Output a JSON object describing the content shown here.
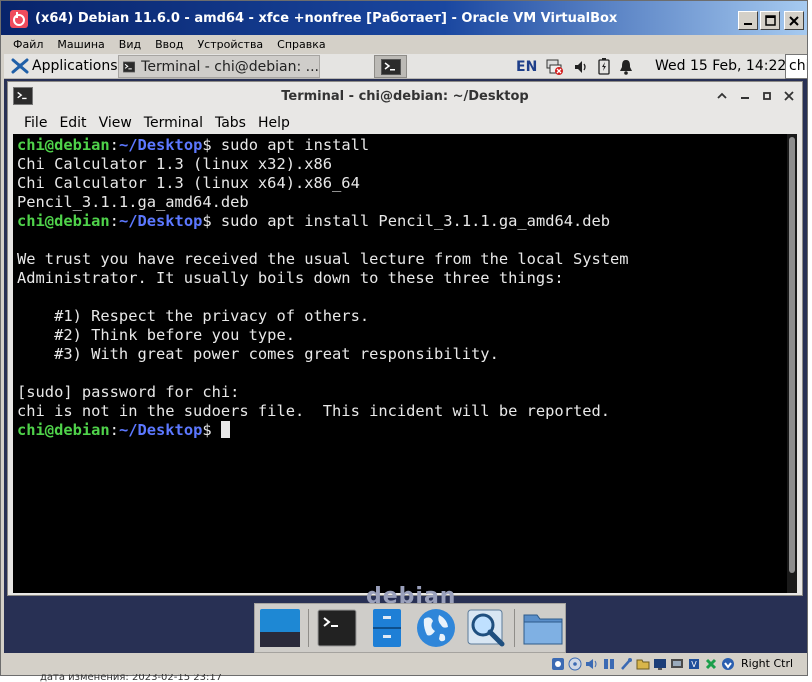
{
  "vbox": {
    "title": "(x64) Debian 11.6.0 - amd64 - xfce +nonfree [Работает] - Oracle VM VirtualBox",
    "menu": [
      "Файл",
      "Машина",
      "Вид",
      "Ввод",
      "Устройства",
      "Справка"
    ],
    "window_controls": {
      "minimize": "_",
      "maximize": "□",
      "close": "✕"
    },
    "status": {
      "host_key": "Right Ctrl"
    }
  },
  "panel": {
    "applications_label": "Applications",
    "taskbar_terminal_label": "Terminal - chi@debian: ...",
    "keyboard_layout": "EN",
    "clock": "Wed 15 Feb, 14:22",
    "user": "chi"
  },
  "terminal": {
    "title": "Terminal - chi@debian: ~/Desktop",
    "menu": [
      "File",
      "Edit",
      "View",
      "Terminal",
      "Tabs",
      "Help"
    ],
    "prompt": {
      "user_host": "chi@debian",
      "sep": ":",
      "path": "~/Desktop",
      "sign": "$"
    },
    "lines": [
      {
        "type": "prompt",
        "cmd": " sudo apt install"
      },
      {
        "type": "out",
        "text": "Chi Calculator 1.3 (linux x32).x86"
      },
      {
        "type": "out",
        "text": "Chi Calculator 1.3 (linux x64).x86_64"
      },
      {
        "type": "out",
        "text": "Pencil_3.1.1.ga_amd64.deb"
      },
      {
        "type": "prompt",
        "cmd": " sudo apt install Pencil_3.1.1.ga_amd64.deb"
      },
      {
        "type": "out",
        "text": ""
      },
      {
        "type": "out",
        "text": "We trust you have received the usual lecture from the local System"
      },
      {
        "type": "out",
        "text": "Administrator. It usually boils down to these three things:"
      },
      {
        "type": "out",
        "text": ""
      },
      {
        "type": "out",
        "text": "    #1) Respect the privacy of others."
      },
      {
        "type": "out",
        "text": "    #2) Think before you type."
      },
      {
        "type": "out",
        "text": "    #3) With great power comes great responsibility."
      },
      {
        "type": "out",
        "text": ""
      },
      {
        "type": "out",
        "text": "[sudo] password for chi:"
      },
      {
        "type": "out",
        "text": "chi is not in the sudoers file.  This incident will be reported."
      },
      {
        "type": "prompt",
        "cmd": " ",
        "cursor": true
      }
    ]
  },
  "desktop": {
    "background_text": "debian"
  },
  "dock": {
    "items": [
      "show-desktop",
      "terminal",
      "file-manager",
      "web-browser",
      "app-finder",
      "home-folder"
    ]
  },
  "colors": {
    "prompt_user": "#4fd24a",
    "prompt_path": "#5c78ff",
    "terminal_bg": "#000000",
    "panel_bg": "#e5e4e2"
  },
  "footer": {
    "text": "дата изменения: 2023-02-15 23:17"
  }
}
